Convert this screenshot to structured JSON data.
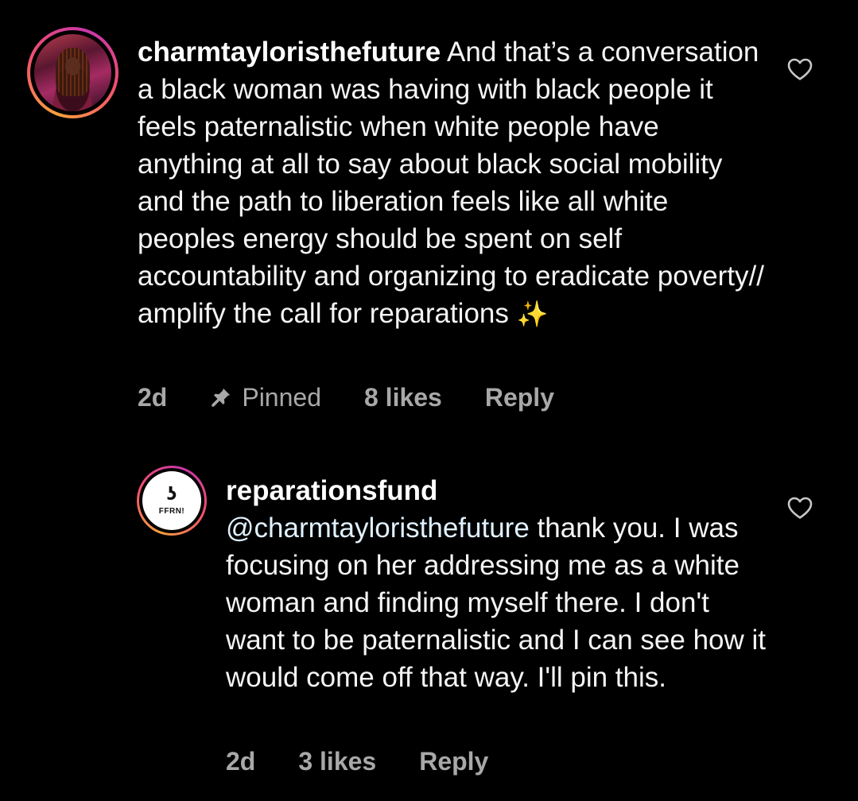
{
  "comments": [
    {
      "username": "charmtayloristhefuture",
      "text": "And that’s a conversation a black woman was having with black people it feels paternalistic when white people have anything at all to say about black social mobility and the path to liberation feels like all white peoples energy should be spent on self accountability and organizing to eradicate poverty// amplify the call for reparations",
      "emoji": "✨",
      "age": "2d",
      "pinned_label": "Pinned",
      "likes": "8 likes",
      "reply_label": "Reply",
      "avatar_icon": "profile-photo",
      "like_icon": "heart-outline-icon"
    },
    {
      "username": "reparationsfund",
      "mention": "@charmtayloristhefuture",
      "text": "thank you. I was focusing on her addressing me as a white woman and finding myself there. I don't want to be paternalistic and I can see how it would come off that way. I'll pin this.",
      "age": "2d",
      "likes": "3 likes",
      "reply_label": "Reply",
      "avatar_logo_mark": "ʖ",
      "avatar_logo_text": "FFRN!",
      "like_icon": "heart-outline-icon"
    }
  ],
  "colors": {
    "background": "#000000",
    "text": "#f5f5f5",
    "meta_text": "#a8a8a8",
    "mention": "#e0f1ff",
    "story_ring_start": "#f9a03f",
    "story_ring_end": "#c837ab"
  }
}
